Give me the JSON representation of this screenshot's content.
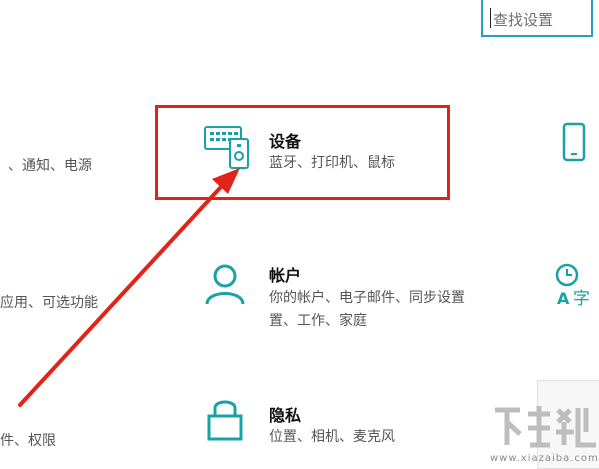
{
  "search": {
    "placeholder": "查找设置"
  },
  "left_column": {
    "item1_sub": "、通知、电源",
    "item2_sub": "应用、可选功能",
    "item3_sub": "件、权限"
  },
  "tiles": {
    "devices": {
      "title": "设备",
      "subtitle": "蓝牙、打印机、鼠标"
    },
    "accounts": {
      "title": "帐户",
      "subtitle_line1": "你的帐户、电子邮件、同步设置",
      "subtitle_line2": "置、工作、家庭"
    },
    "privacy": {
      "title": "隐私",
      "subtitle": "位置、相机、麦克风"
    }
  },
  "watermark": {
    "text": "www.xiazaiba.com"
  },
  "colors": {
    "accent": "#2a9fbb",
    "highlight": "#e2231a",
    "icon": "#17a2a5"
  }
}
